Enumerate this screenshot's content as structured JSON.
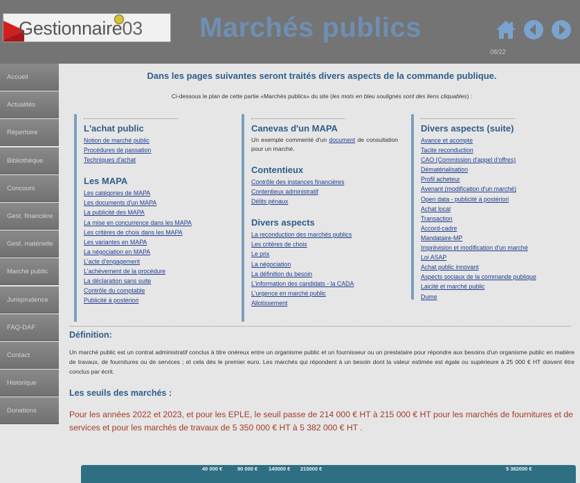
{
  "header": {
    "logo_text": "Gestionnaire",
    "logo_number": "03",
    "site_title": "Marchés publics",
    "page_indicator": "08/22",
    "icons": [
      "home-icon",
      "previous-icon",
      "next-icon"
    ]
  },
  "sidebar": {
    "items": [
      {
        "label": "Accueil"
      },
      {
        "label": "Actualités"
      },
      {
        "label": "Répertoire"
      },
      {
        "label": "Bibliothèque"
      },
      {
        "label": "Concours"
      },
      {
        "label": "Gest. financière"
      },
      {
        "label": "Gest. matérielle"
      },
      {
        "label": "Marché public"
      },
      {
        "label": "Jurisprudence"
      },
      {
        "label": "FAQ-DAF"
      },
      {
        "label": "Contact"
      },
      {
        "label": "Historique"
      },
      {
        "label": "Donations"
      }
    ]
  },
  "main": {
    "intro": "Dans les pages suivantes seront traités divers aspects de la commande publique.",
    "plan_note_a": "Ci-dessous le plan de cette partie «Marchés publics» du site (",
    "plan_note_b": "les mots en bleu soulignés sont des liens cliquables",
    "plan_note_c": ") :",
    "col1": {
      "title1": "L'achat public",
      "links1": [
        "Notion de marché public",
        "Procédures de passation",
        "Techniques d'achat"
      ],
      "title2": "Les MAPA",
      "links2": [
        "Les catégories de MAPA",
        "Les documents d'un MAPA",
        "La publicité des MAPA",
        "La mise en concurrence dans les MAPA",
        "Les critères de choix dans les MAPA",
        "Les variantes en MAPA",
        "La négociation en MAPA",
        "L'acte d'engagement",
        "L'achèvement de la procédure",
        "La déclaration sans suite",
        "Contrôle du comptable",
        "Publicité à postériori"
      ]
    },
    "col2": {
      "title1": "Canevas d'un MAPA",
      "desc_a": "Un exemple commenté d'un",
      "desc_link": "document",
      "desc_b": "de consultation pour un marché.",
      "title2": "Contentieux",
      "links2": [
        "Contrôle des instances financières",
        "Contentieux administratif",
        "Délits pénaux"
      ],
      "title3": "Divers aspects",
      "links3": [
        "La reconduction des marchés publics",
        "Les critères de choix",
        "Le prix",
        "La négociation",
        "La définition du besoin",
        "L'information des candidats - la CADA",
        "L'urgence en marché public",
        "Allotissement"
      ]
    },
    "col3": {
      "title1": "Divers aspects (suite)",
      "links1": [
        "Avance et acompte",
        "Tacite reconduction",
        "CAO (Commission d'appel d'offres)",
        "Dématérialisation",
        "Profil acheteur",
        "Avenant (modification d'un marché)",
        "Open data - publicité à postériori",
        "Achat local",
        "Transaction",
        "Accord-cadre",
        "Mandataire-MP",
        "Imprévision et modification d'un marché",
        "Loi ASAP",
        "Achat public innovant",
        "Aspects sociaux de la commande publique",
        "Laicité et marché public",
        "Dume"
      ]
    },
    "definition_title": "Définition:",
    "definition_text": "Un marché public est un contrat administratif conclus à titre onéreux entre un organisme public et un fournisseur ou un prestataire pour répondre aux besoins d'un organisme public en matière de travaux, de fournitures ou de services ; et cela dés le premier euro. Les marchés qui répondent à un besoin dont la valeur estimée est égale ou supérieure à 25 000 € HT doivent être conclus par écrit.",
    "seuils_title": "Les seuils des marchés :",
    "seuils_text": "Pour les années 2022 et 2023, et pour les EPLE, le seuil passe de 214 000 € HT à 215 000 € HT pour les marchés de fournitures et de services et pour les marchés de travaux de 5 350 000 € HT à 5 382 000 € HT .",
    "table_values": [
      "40 000 €",
      "90 000 €",
      "140000 €",
      "215000 €",
      "5 382000 €"
    ]
  },
  "colors": {
    "header_bg": "#747474",
    "title_blue": "#6e8fb3",
    "heading_blue": "#2f5d8a",
    "link_blue": "#1e3d8f",
    "seuils_red": "#a33a2a",
    "table_teal": "#2e6f84"
  }
}
